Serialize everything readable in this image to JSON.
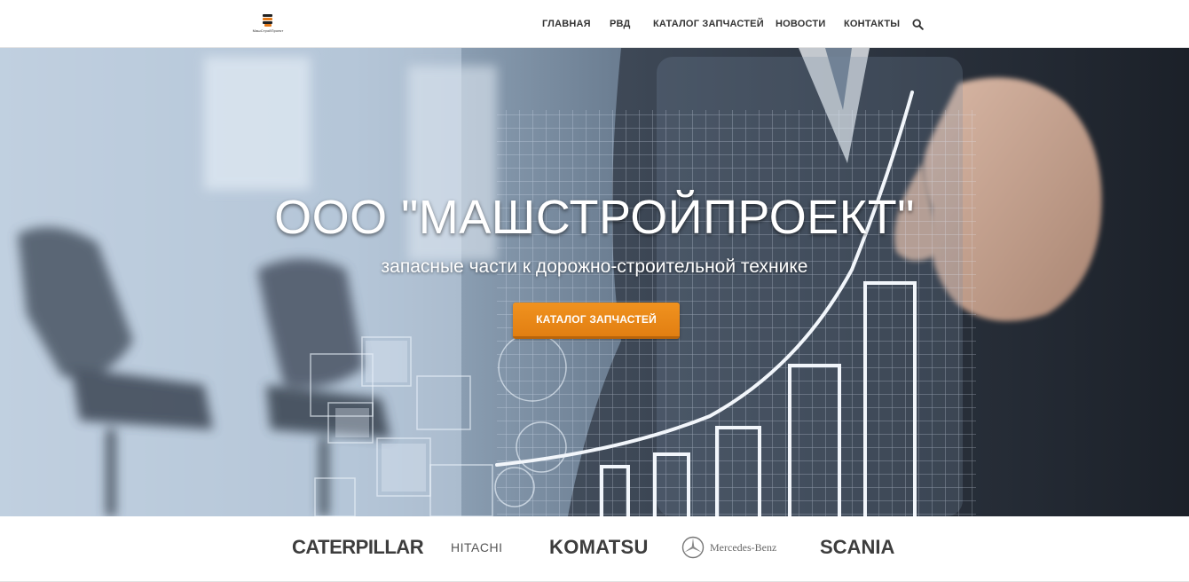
{
  "header": {
    "logo_text": "МашСтройПроект",
    "nav": [
      {
        "label": "ГЛАВНАЯ"
      },
      {
        "label": "РВД"
      },
      {
        "label": "КАТАЛОГ ЗАПЧАСТЕЙ"
      },
      {
        "label": "НОВОСТИ"
      },
      {
        "label": "КОНТАКТЫ"
      }
    ],
    "search_icon": "search-icon"
  },
  "hero": {
    "title": "ООО \"МАШСТРОЙПРОЕКТ\"",
    "subtitle": "запасные части к дорожно-строительной технике",
    "cta_label": "КАТАЛОГ ЗАПЧАСТЕЙ"
  },
  "brands": {
    "items": [
      {
        "name": "CATERPILLAR"
      },
      {
        "name": "HITACHI"
      },
      {
        "name": "KOMATSU"
      },
      {
        "name": "Mercedes-Benz"
      },
      {
        "name": "SCANIA"
      }
    ]
  },
  "colors": {
    "accent": "#E8861A",
    "nav_text": "#333333",
    "hero_text": "#FFFFFF"
  }
}
